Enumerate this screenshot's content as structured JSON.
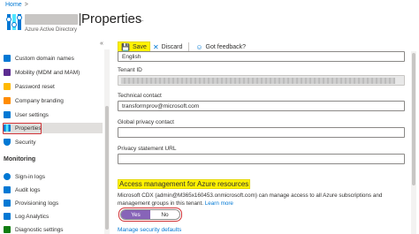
{
  "breadcrumb": {
    "home": "Home",
    "separator": ">"
  },
  "header": {
    "title": "Properties",
    "subtitle": "Azure Active Directory",
    "more": "..."
  },
  "toolbar": {
    "save": "Save",
    "discard": "Discard",
    "feedback": "Got feedback?"
  },
  "sidebar": {
    "collapse": "«",
    "items": [
      {
        "label": "Custom domain names",
        "icon": "domain-icon",
        "color": "#0078d4"
      },
      {
        "label": "Mobility (MDM and MAM)",
        "icon": "mobility-icon",
        "color": "#5c2d91"
      },
      {
        "label": "Password reset",
        "icon": "key-icon",
        "color": "#ffb900"
      },
      {
        "label": "Company branding",
        "icon": "branding-icon",
        "color": "#ff8c00"
      },
      {
        "label": "User settings",
        "icon": "user-settings-icon",
        "color": "#0078d4"
      },
      {
        "label": "Properties",
        "icon": "properties-icon",
        "color": "#0078d4"
      },
      {
        "label": "Security",
        "icon": "shield-icon",
        "color": "#0078d4"
      }
    ],
    "monitoring_title": "Monitoring",
    "monitoring_items": [
      {
        "label": "Sign-in logs",
        "icon": "signin-icon",
        "color": "#0078d4"
      },
      {
        "label": "Audit logs",
        "icon": "audit-icon",
        "color": "#0078d4"
      },
      {
        "label": "Provisioning logs",
        "icon": "provisioning-icon",
        "color": "#0078d4"
      },
      {
        "label": "Log Analytics",
        "icon": "analytics-icon",
        "color": "#0078d4"
      },
      {
        "label": "Diagnostic settings",
        "icon": "diagnostic-icon",
        "color": "#107c10"
      }
    ]
  },
  "form": {
    "language_value": "English",
    "tenant_id_label": "Tenant ID",
    "technical_contact_label": "Technical contact",
    "technical_contact_value": "transformprov@microsoft.com",
    "global_privacy_label": "Global privacy contact",
    "privacy_url_label": "Privacy statement URL",
    "access_heading": "Access management for Azure resources",
    "access_desc_1": "Microsoft CDX (admin@M365x160453.onmicrosoft.com) can manage access to all Azure subscriptions and",
    "access_desc_2": "management groups in this tenant.",
    "learn_more": "Learn more",
    "toggle_yes": "Yes",
    "toggle_no": "No",
    "manage_security": "Manage security defaults"
  }
}
